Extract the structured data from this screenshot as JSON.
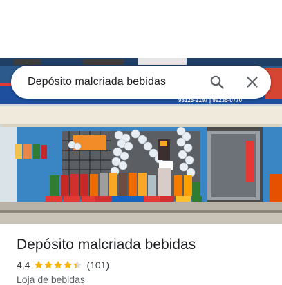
{
  "search": {
    "query": "Depósito malcriada bebidas"
  },
  "place": {
    "name": "Depósito malcriada bebidas",
    "rating": "4,4",
    "rating_value": 4.4,
    "rating_max": 5,
    "review_count": "(101)",
    "category": "Loja de bebidas"
  },
  "photo": {
    "phone_sign": "98125-2197 | 99235-0770",
    "icon": "storefront-photo"
  },
  "colors": {
    "star": "#f4b400",
    "star_empty": "#dadce0",
    "title": "#202124",
    "secondary": "#5f6368"
  }
}
